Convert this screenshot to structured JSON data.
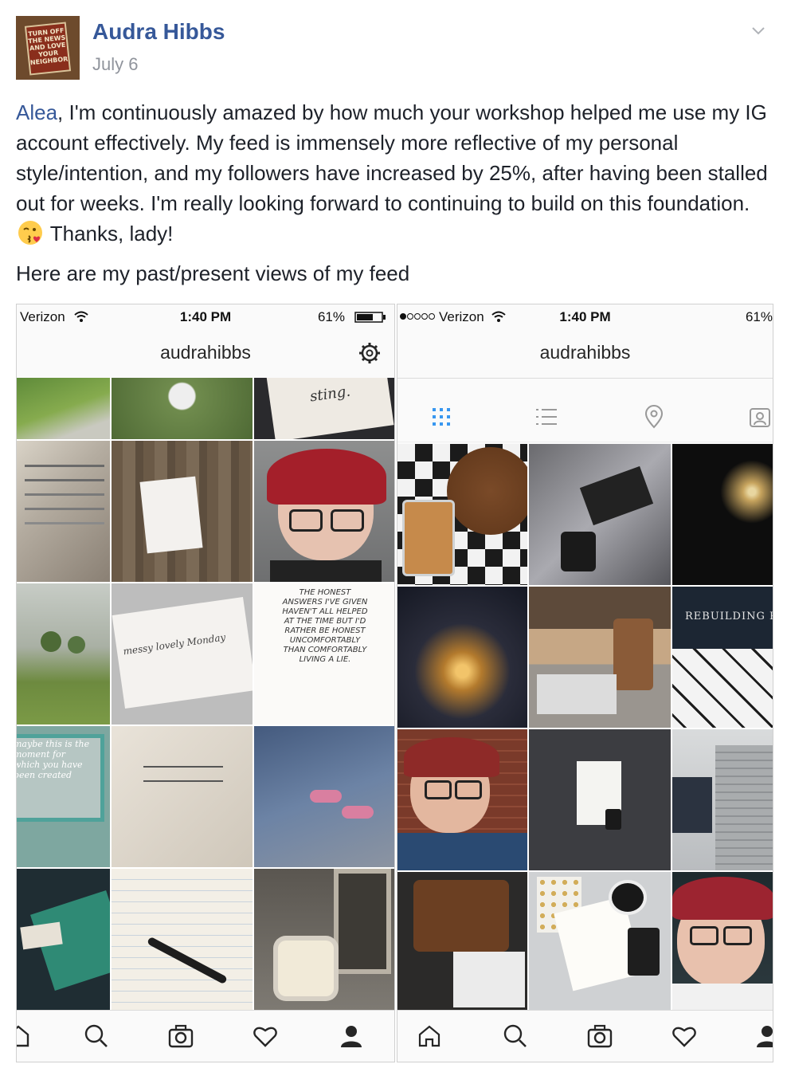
{
  "post": {
    "author": "Audra Hibbs",
    "date": "July 6",
    "avatar_text": "TURN OFF THE NEWS AND LOVE YOUR NEIGHBOR",
    "mention": "Alea",
    "body_main": ", I'm continuously amazed by how much your workshop helped me use my IG account effectively. My feed is immensely more reflective of my personal style/intention, and my followers have increased by 25%, after having been stalled out for weeks. I'm really looking forward to continuing to build on this foundation.",
    "body_end": " Thanks, lady!",
    "body_second": "Here are my past/present views of my feed"
  },
  "left_screenshot": {
    "status": {
      "carrier": "Verizon",
      "time": "1:40 PM",
      "battery": "61%"
    },
    "username": "audrahibbs",
    "tile_texts": {
      "sting": "sting.",
      "monday": "messy lovely Monday",
      "honest": "THE HONEST ANSWERS I'VE GIVEN HAVEN'T ALL HELPED AT THE TIME BUT I'D RATHER BE HONEST UNCOMFORTABLY THAN COMFORTABLY LIVING A LIE.",
      "moment": "maybe this is the moment for which you have been created"
    }
  },
  "right_screenshot": {
    "status": {
      "carrier": "Verizon",
      "time": "1:40 PM",
      "battery": "61%"
    },
    "username": "audrahibbs",
    "tile_texts": {
      "rebuilding": "REBUILDING RU"
    }
  },
  "colors": {
    "link": "#365899",
    "date": "#90949c",
    "text": "#1d2129",
    "tab_active": "#3897f0"
  }
}
